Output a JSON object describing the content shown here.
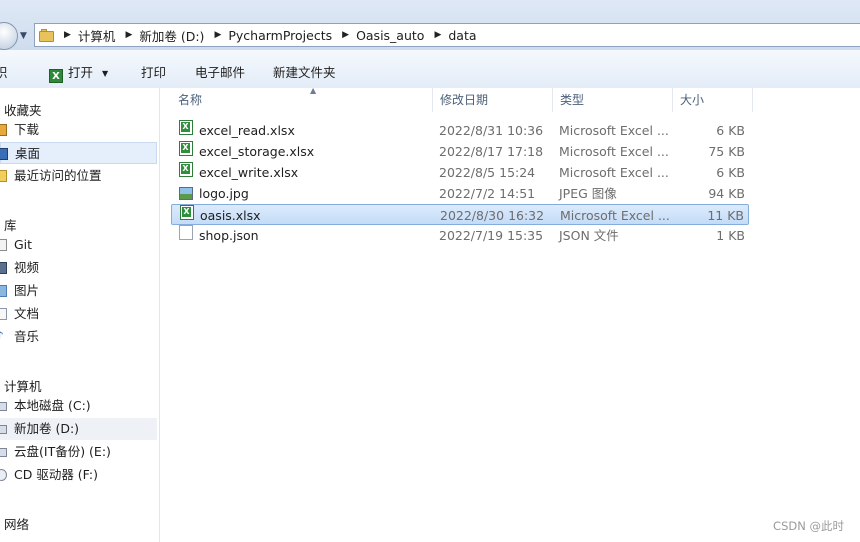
{
  "address_bar": {
    "path": [
      "计算机",
      "新加卷 (D:)",
      "PycharmProjects",
      "Oasis_auto",
      "data"
    ]
  },
  "toolbar": {
    "organize_partial": "织",
    "open_label": "打开",
    "print_label": "打印",
    "email_label": "电子邮件",
    "new_folder_label": "新建文件夹"
  },
  "navigation": {
    "favorites_label": "收藏夹",
    "favorites": [
      "下载",
      "桌面",
      "最近访问的位置"
    ],
    "libraries_label": "库",
    "libraries": [
      "Git",
      "视频",
      "图片",
      "文档",
      "音乐"
    ],
    "computer_label": "计算机",
    "drives": [
      "本地磁盘 (C:)",
      "新加卷 (D:)",
      "云盘(IT备份) (E:)",
      "CD 驱动器 (F:)"
    ],
    "network_label": "网络"
  },
  "columns": {
    "name": "名称",
    "date": "修改日期",
    "type": "类型",
    "size": "大小"
  },
  "files": [
    {
      "name": "excel_read.xlsx",
      "date": "2022/8/31 10:36",
      "type": "Microsoft Excel ...",
      "size": "6 KB",
      "icon": "excel-file-icon"
    },
    {
      "name": "excel_storage.xlsx",
      "date": "2022/8/17 17:18",
      "type": "Microsoft Excel ...",
      "size": "75 KB",
      "icon": "excel-file-icon"
    },
    {
      "name": "excel_write.xlsx",
      "date": "2022/8/5 15:24",
      "type": "Microsoft Excel ...",
      "size": "6 KB",
      "icon": "excel-file-icon"
    },
    {
      "name": "logo.jpg",
      "date": "2022/7/2 14:51",
      "type": "JPEG 图像",
      "size": "94 KB",
      "icon": "image-file-icon"
    },
    {
      "name": "oasis.xlsx",
      "date": "2022/8/30 16:32",
      "type": "Microsoft Excel ...",
      "size": "11 KB",
      "icon": "excel-file-icon"
    },
    {
      "name": "shop.json",
      "date": "2022/7/19 15:35",
      "type": "JSON 文件",
      "size": "1 KB",
      "icon": "json-file-icon"
    }
  ],
  "selected_file": "oasis.xlsx",
  "watermark": "CSDN @此时"
}
